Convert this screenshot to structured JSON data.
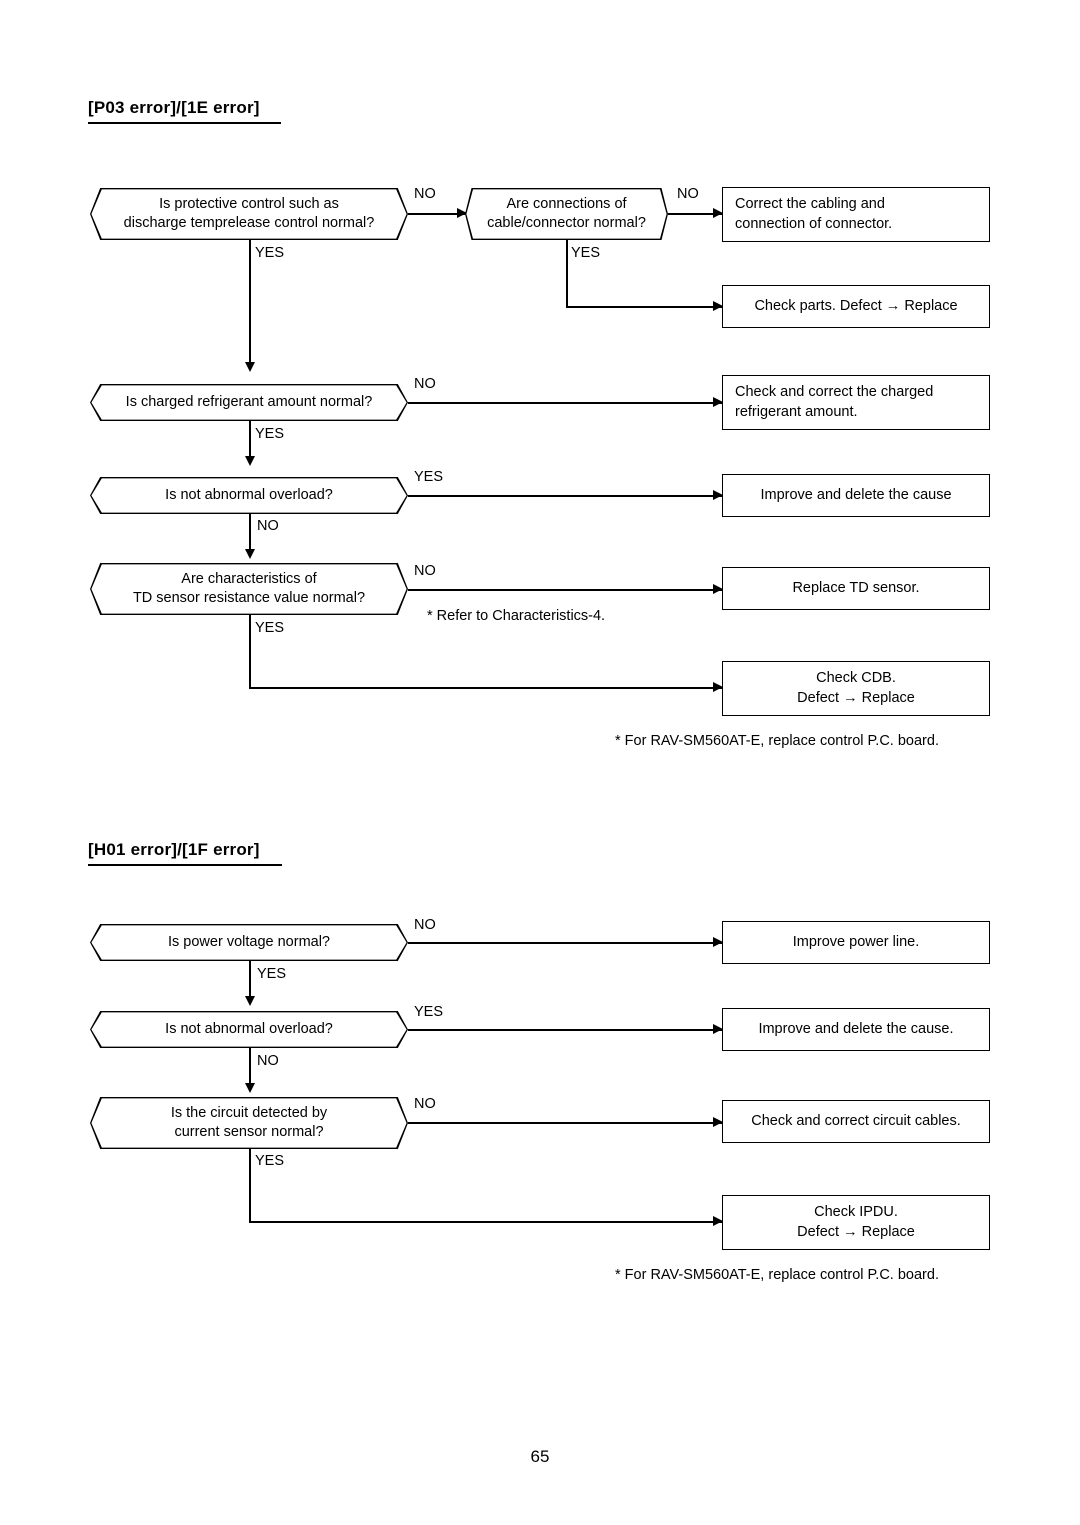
{
  "page": {
    "number": "65"
  },
  "sections": [
    {
      "title": "[P03 error]/[1E error]",
      "decisions": [
        {
          "line1": "Is protective control such as",
          "line2": "discharge temprelease control normal?"
        },
        {
          "line1": "Are connections of",
          "line2": "cable/connector normal?"
        },
        {
          "line1": "Is charged refrigerant amount normal?",
          "line2": ""
        },
        {
          "line1": "Is not abnormal overload?",
          "line2": ""
        },
        {
          "line1": "Are characteristics of",
          "line2": "TD sensor resistance value normal?"
        }
      ],
      "actions": [
        {
          "line1": "Correct the cabling and",
          "line2": "connection of connector."
        },
        {
          "line1": "Check parts. Defect → Replace",
          "line2": ""
        },
        {
          "line1": "Check and correct the charged",
          "line2": "refrigerant amount."
        },
        {
          "line1": "Improve and delete the cause",
          "line2": ""
        },
        {
          "line1": "Replace TD sensor.",
          "line2": ""
        },
        {
          "line1": "Check CDB.",
          "line2": "Defect → Replace"
        }
      ],
      "branch_labels": {
        "q1_no": "NO",
        "q1_yes": "YES",
        "q2_no": "NO",
        "q2_yes": "YES",
        "q3_no": "NO",
        "q3_yes": "YES",
        "q4_yes": "YES",
        "q4_no": "NO",
        "q5_no": "NO",
        "q5_yes": "YES"
      },
      "notes": [
        "* Refer to Characteristics-4.",
        "* For RAV-SM560AT-E, replace control P.C. board."
      ]
    },
    {
      "title": "[H01 error]/[1F error]",
      "decisions": [
        {
          "line1": "Is power voltage normal?",
          "line2": ""
        },
        {
          "line1": "Is not abnormal overload?",
          "line2": ""
        },
        {
          "line1": "Is the circuit detected by",
          "line2": "current sensor normal?"
        }
      ],
      "actions": [
        {
          "line1": "Improve power line.",
          "line2": ""
        },
        {
          "line1": "Improve and delete the cause.",
          "line2": ""
        },
        {
          "line1": "Check and correct circuit cables.",
          "line2": ""
        },
        {
          "line1": "Check IPDU.",
          "line2": "Defect → Replace"
        }
      ],
      "branch_labels": {
        "q1_no": "NO",
        "q1_yes": "YES",
        "q2_yes": "YES",
        "q2_no": "NO",
        "q3_no": "NO",
        "q3_yes": "YES"
      },
      "notes": [
        "* For RAV-SM560AT-E, replace control P.C. board."
      ]
    }
  ]
}
